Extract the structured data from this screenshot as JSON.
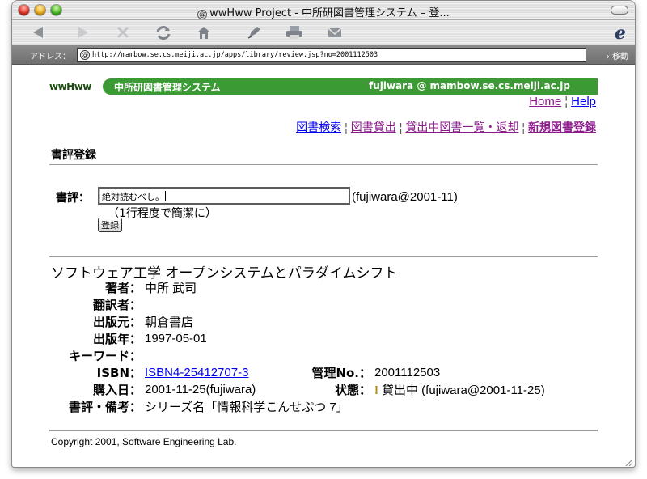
{
  "window": {
    "title": "wwHww Project - 中所研図書管理システム – 登..."
  },
  "addressbar": {
    "label": "アドレス：",
    "url": "http://mambow.se.cs.meiji.ac.jp/apps/library/review.jsp?no=2001112503",
    "go_label": "› 移動"
  },
  "header": {
    "logo": "wwHww",
    "system_name": "中所研図書管理システム",
    "user": "fujiwara @ mambow.se.cs.meiji.ac.jp",
    "accent_color": "#3b9a34"
  },
  "toplinks": {
    "home": "Home",
    "sep": "¦",
    "help": "Help"
  },
  "nav": {
    "search": "図書検索",
    "lend": "図書貸出",
    "list": "貸出中図書一覧・返却",
    "register": "新規図書登録",
    "sep": "¦"
  },
  "section_title": "書評登録",
  "review_form": {
    "label": "書評：",
    "value": "絶対読むべし。",
    "meta": "(fujiwara@2001-11)",
    "hint": "（1行程度で簡潔に）",
    "submit_label": "登録"
  },
  "book": {
    "title": "ソフトウェア工学 オープンシステムとパラダイムシフト",
    "author_label": "著者：",
    "author": "中所 武司",
    "translator_label": "翻訳者：",
    "translator": "",
    "publisher_label": "出版元：",
    "publisher": "朝倉書店",
    "year_label": "出版年：",
    "year": "1997-05-01",
    "keyword_label": "キーワード：",
    "keyword": "",
    "isbn_label": "ISBN：",
    "isbn": "ISBN4-25412707-3",
    "mgmt_label": "管理No.：",
    "mgmt_no": "2001112503",
    "purchase_label": "購入日：",
    "purchase": "2001-11-25(fujiwara)",
    "status_label": "状態：",
    "status_mark": "!",
    "status": "貸出中 (fujiwara@2001-11-25)",
    "notes_label": "書評・備考：",
    "notes": "シリーズ名「情報科学こんせぷつ 7」"
  },
  "footer": {
    "copyright": "Copyright 2001, Software Engineering Lab."
  }
}
